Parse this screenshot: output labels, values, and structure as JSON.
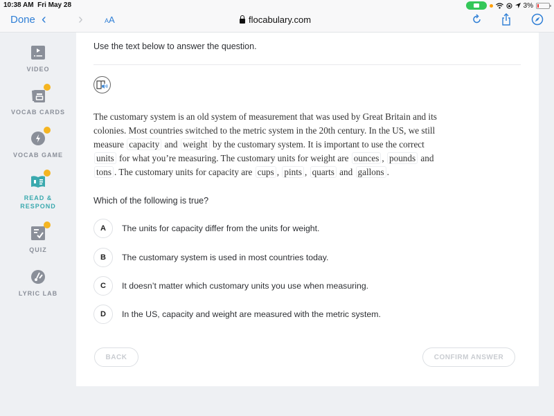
{
  "status_bar": {
    "time": "10:38 AM",
    "date": "Fri May 28",
    "battery": "3%"
  },
  "browser": {
    "done_label": "Done",
    "text_size_label_small": "A",
    "text_size_label_large": "A",
    "url": "flocabulary.com"
  },
  "sidebar": {
    "items": [
      {
        "label": "VIDEO",
        "icon": "video-icon",
        "badge": false,
        "active": false
      },
      {
        "label": "VOCAB CARDS",
        "icon": "vocab-cards-icon",
        "badge": true,
        "active": false
      },
      {
        "label": "VOCAB GAME",
        "icon": "vocab-game-icon",
        "badge": true,
        "active": false
      },
      {
        "label_line1": "READ &",
        "label_line2": "RESPOND",
        "icon": "read-respond-icon",
        "badge": true,
        "active": true
      },
      {
        "label": "QUIZ",
        "icon": "quiz-icon",
        "badge": true,
        "active": false
      },
      {
        "label": "LYRIC LAB",
        "icon": "lyric-lab-icon",
        "badge": false,
        "active": false
      }
    ]
  },
  "main": {
    "instruction": "Use the text below to answer the question.",
    "passage": {
      "s1": "The customary system is an old system of measurement that was used by Great Britain and its colonies. Most countries switched to the metric system in the 20th century. In the US, we still measure ",
      "v_capacity": "capacity",
      "and1": " and ",
      "v_weight": "weight",
      "s2": " by the customary system. It is important to use the correct ",
      "v_units": "units",
      "s3": " for what you’re measuring. The customary units for weight are ",
      "v_ounces": "ounces",
      "comma1": ", ",
      "v_pounds": "pounds",
      "and2": " and ",
      "v_tons": "tons",
      "s4": ". The customary units for capacity are ",
      "v_cups": "cups",
      "comma2": ", ",
      "v_pints": "pints",
      "comma3": ", ",
      "v_quarts": "quarts",
      "and3": " and ",
      "v_gallons": "gallons",
      "end": "."
    },
    "question": "Which of the following is true?",
    "options": [
      {
        "letter": "A",
        "text": "The units for capacity differ from the units for weight."
      },
      {
        "letter": "B",
        "text": "The customary system is used in most countries today."
      },
      {
        "letter": "C",
        "text": "It doesn’t matter which customary units you use when measuring."
      },
      {
        "letter": "D",
        "text": "In the US, capacity and weight are measured with the metric system."
      }
    ],
    "back_label": "BACK",
    "confirm_label": "CONFIRM ANSWER"
  },
  "colors": {
    "accent_blue": "#2f7fd6",
    "active_teal": "#3aa9ae",
    "badge_orange": "#f5b521"
  }
}
